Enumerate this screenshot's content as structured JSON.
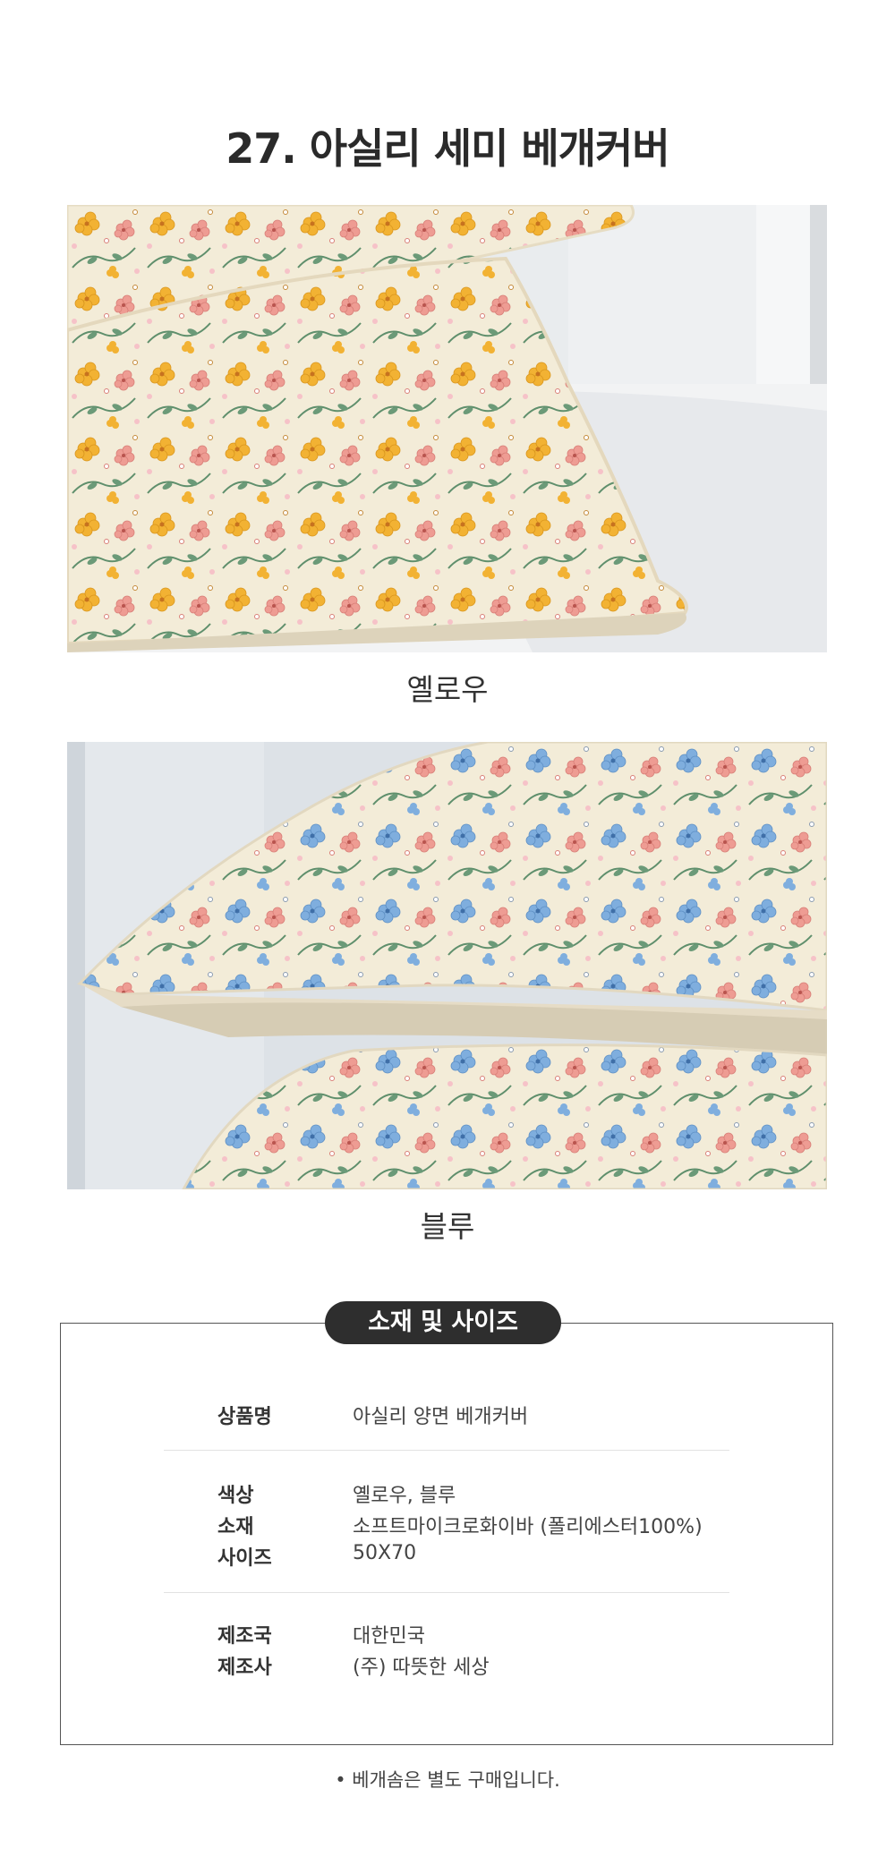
{
  "title": "27. 아실리 세미 베개커버",
  "products": [
    {
      "caption": "옐로우"
    },
    {
      "caption": "블루"
    }
  ],
  "spec": {
    "heading": "소재 및 사이즈",
    "groups": [
      {
        "rows": [
          {
            "label": "상품명",
            "value": "아실리 양면 베개커버"
          }
        ]
      },
      {
        "rows": [
          {
            "label": "색상",
            "value": "옐로우, 블루"
          },
          {
            "label": "소재",
            "value": "소프트마이크로화이바 (폴리에스터100%)"
          },
          {
            "label": "사이즈",
            "value": "50X70"
          }
        ]
      },
      {
        "rows": [
          {
            "label": "제조국",
            "value": "대한민국"
          },
          {
            "label": "제조사",
            "value": "(주) 따뜻한 세상"
          }
        ]
      }
    ]
  },
  "note": "• 베개솜은 별도 구매입니다.",
  "colors": {
    "fabric_bg": "#f3ecd8",
    "yellow_flower": "#f2b233",
    "pink_flower": "#ee9c93",
    "blue_flower": "#7faede",
    "leaf": "#5f8f6c",
    "pill_bg": "#2e2e2e"
  }
}
